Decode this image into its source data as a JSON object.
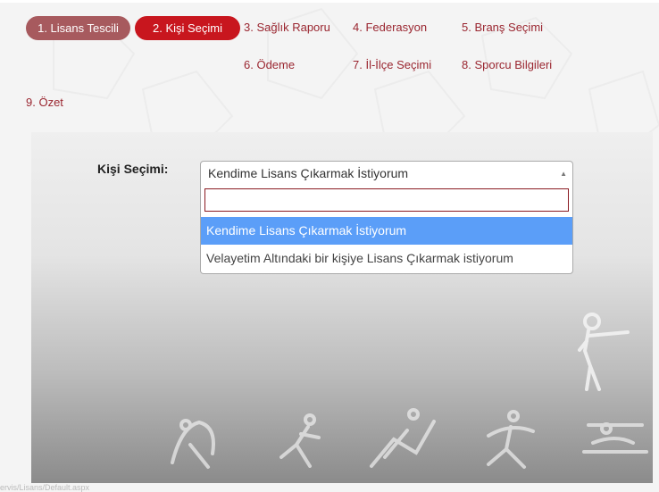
{
  "steps": [
    {
      "label": "1. Lisans Tescili"
    },
    {
      "label": "2. Kişi Seçimi"
    },
    {
      "label": "3. Sağlık Raporu"
    },
    {
      "label": "4. Federasyon"
    },
    {
      "label": "5. Branş Seçimi"
    },
    {
      "label": "6. Ödeme"
    },
    {
      "label": "7. İl-İlçe Seçimi"
    },
    {
      "label": "8. Sporcu Bilgileri"
    },
    {
      "label": "9. Özet"
    }
  ],
  "form": {
    "label": "Kişi Seçimi:",
    "selected": "Kendime Lisans Çıkarmak İstiyorum",
    "search_value": "",
    "options": [
      {
        "label": "Kendime Lisans Çıkarmak İstiyorum",
        "highlighted": true
      },
      {
        "label": "Velayetim Altındaki bir kişiye Lisans Çıkarmak istiyorum",
        "highlighted": false
      }
    ]
  },
  "status_bar": {
    "text": "ervis/Lisans/Default.aspx"
  },
  "colors": {
    "active_step": "#c8161e",
    "completed_step": "#a75a5e",
    "step_text": "#9a2630",
    "highlight": "#5b9ef8"
  }
}
